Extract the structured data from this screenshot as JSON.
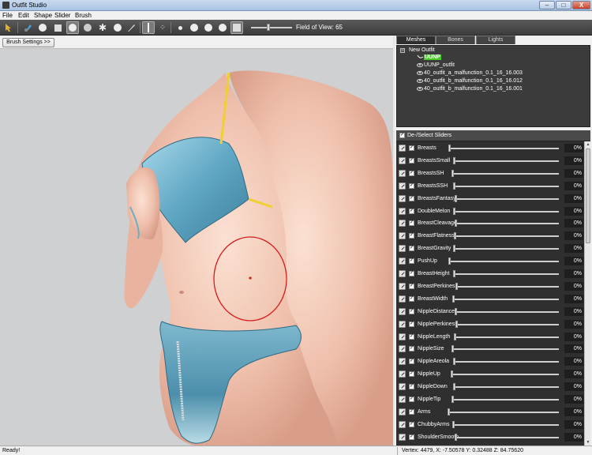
{
  "window": {
    "title": "Outfit Studio",
    "minimize_glyph": "–",
    "maximize_glyph": "□",
    "close_glyph": "X"
  },
  "menu": [
    "File",
    "Edit",
    "Shape",
    "Slider",
    "Brush"
  ],
  "toolbar": {
    "fov_label": "Field of View: 65",
    "fov_value": 65,
    "tools": [
      "select-tool-icon",
      "mask-brush-icon",
      "inflate-brush-icon",
      "deflate-brush-icon",
      "move-brush-icon",
      "smooth-brush-icon",
      "weight-brush-icon",
      "color-brush-icon",
      "transform-icon",
      "pivot-icon",
      "vertex-select-icon",
      "shading-icon"
    ]
  },
  "brush_settings_label": "Brush Settings >>",
  "panel": {
    "tabs": [
      "Meshes",
      "Bones",
      "Lights"
    ],
    "active_tab": "Meshes",
    "outfit_root": "New Outfit",
    "meshes": [
      {
        "name": "UUNP",
        "highlighted": true
      },
      {
        "name": "UUNP_outfit",
        "highlighted": false
      },
      {
        "name": "40_outfit_a_malfunction_0.1_16_16.003",
        "highlighted": false
      },
      {
        "name": "40_outfit_b_malfunction_0.1_16_16.012",
        "highlighted": false
      },
      {
        "name": "40_outfit_b_malfunction_0.1_16_16.001",
        "highlighted": false
      }
    ],
    "sliders_header": "De-/Select Sliders",
    "checkbox_glyph": "✓",
    "collapse_glyph": "−",
    "sliders": [
      {
        "name": "Breasts",
        "value": "0%",
        "track_start": 0.26
      },
      {
        "name": "BreastsSmall",
        "value": "0%",
        "track_start": 0.41
      },
      {
        "name": "BreastsSH",
        "value": "0%",
        "track_start": 0.36
      },
      {
        "name": "BreastsSSH",
        "value": "0%",
        "track_start": 0.41
      },
      {
        "name": "BreastsFantasy",
        "value": "0%",
        "track_start": 0.48
      },
      {
        "name": "DoubleMelon",
        "value": "0%",
        "track_start": 0.43
      },
      {
        "name": "BreastCleavage",
        "value": "0%",
        "track_start": 0.48
      },
      {
        "name": "BreastFlatness",
        "value": "0%",
        "track_start": 0.46
      },
      {
        "name": "BreastGravity",
        "value": "0%",
        "track_start": 0.42
      },
      {
        "name": "PushUp",
        "value": "0%",
        "track_start": 0.26
      },
      {
        "name": "BreastHeight",
        "value": "0%",
        "track_start": 0.42
      },
      {
        "name": "BreastPerkiness",
        "value": "0%",
        "track_start": 0.5
      },
      {
        "name": "BreastWidth",
        "value": "0%",
        "track_start": 0.4
      },
      {
        "name": "NippleDistance",
        "value": "0%",
        "track_start": 0.48
      },
      {
        "name": "NipplePerkiness",
        "value": "0%",
        "track_start": 0.51
      },
      {
        "name": "NippleLength",
        "value": "0%",
        "track_start": 0.44
      },
      {
        "name": "NippleSize",
        "value": "0%",
        "track_start": 0.38
      },
      {
        "name": "NippleAreola",
        "value": "0%",
        "track_start": 0.42
      },
      {
        "name": "NippleUp",
        "value": "0%",
        "track_start": 0.35
      },
      {
        "name": "NippleDown",
        "value": "0%",
        "track_start": 0.41
      },
      {
        "name": "NippleTip",
        "value": "0%",
        "track_start": 0.36
      },
      {
        "name": "Arms",
        "value": "0%",
        "track_start": 0.23
      },
      {
        "name": "ChubbyArms",
        "value": "0%",
        "track_start": 0.4
      },
      {
        "name": "ShoulderSmooth",
        "value": "0%",
        "track_start": 0.47
      }
    ]
  },
  "status": {
    "left": "Ready!",
    "right": "Vertex: 4479, X: -7.50578 Y: 0.32488 Z: 84.75620"
  },
  "colors": {
    "toolbar_bg": "#4a4a4a",
    "panel_dark": "#2f2f2f",
    "highlight_green": "#44cc22",
    "brush_circle": "#d81c1c",
    "viewport_bg": "#cfd0d2"
  }
}
